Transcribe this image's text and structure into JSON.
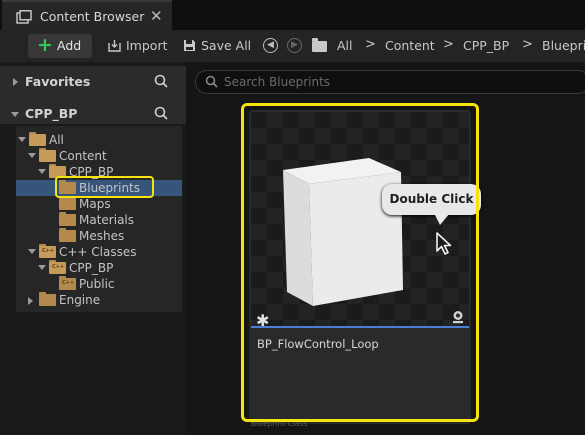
{
  "tab": {
    "title": "Content Browser",
    "close": "✕"
  },
  "toolbar": {
    "add_label": "Add",
    "import_label": "Import",
    "save_all_label": "Save All",
    "breadcrumbs": [
      "All",
      "Content",
      "CPP_BP",
      "Blueprints"
    ],
    "separator": ">"
  },
  "left_panel": {
    "favorites_label": "Favorites",
    "project_label": "CPP_BP",
    "tree": [
      {
        "label": "All",
        "depth": 0,
        "expanded": true,
        "selected": false,
        "kind": "folder"
      },
      {
        "label": "Content",
        "depth": 1,
        "expanded": true,
        "selected": false,
        "kind": "folder"
      },
      {
        "label": "CPP_BP",
        "depth": 2,
        "expanded": true,
        "selected": false,
        "kind": "folder"
      },
      {
        "label": "Blueprints",
        "depth": 3,
        "expanded": false,
        "selected": true,
        "kind": "folder"
      },
      {
        "label": "Maps",
        "depth": 3,
        "expanded": false,
        "selected": false,
        "kind": "folder"
      },
      {
        "label": "Materials",
        "depth": 3,
        "expanded": false,
        "selected": false,
        "kind": "folder"
      },
      {
        "label": "Meshes",
        "depth": 3,
        "expanded": false,
        "selected": false,
        "kind": "folder"
      },
      {
        "label": "C++ Classes",
        "depth": 1,
        "expanded": true,
        "selected": false,
        "kind": "cpp"
      },
      {
        "label": "CPP_BP",
        "depth": 2,
        "expanded": true,
        "selected": false,
        "kind": "cpp"
      },
      {
        "label": "Public",
        "depth": 3,
        "expanded": false,
        "selected": false,
        "kind": "cpp"
      },
      {
        "label": "Engine",
        "depth": 1,
        "expanded": false,
        "selected": false,
        "kind": "folder"
      }
    ]
  },
  "search": {
    "placeholder": "Search Blueprints"
  },
  "asset": {
    "name": "BP_FlowControl_Loop",
    "type": "Blueprint Class"
  },
  "annotation": {
    "callout": "Double Click"
  },
  "colors": {
    "highlight": "#f4e30c",
    "accent_blue": "#4a7fd4",
    "selection": "#35567a",
    "folder": "#b48a4c",
    "add_plus": "#34c759"
  }
}
